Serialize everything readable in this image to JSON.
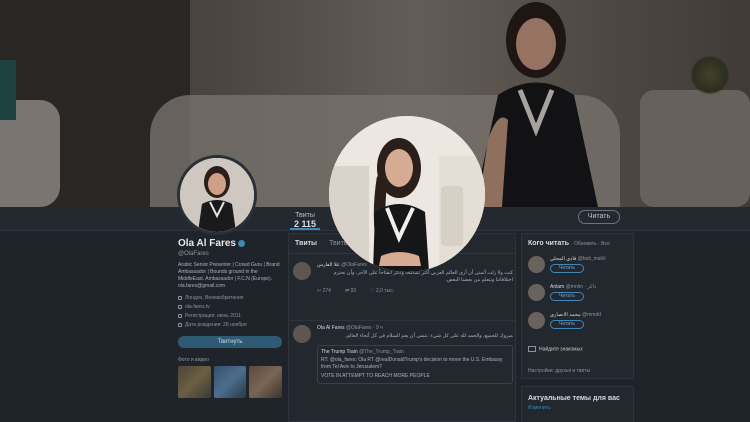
{
  "header": {
    "tab_tweets_label": "Твиты",
    "tab_tweets_value": "2 115",
    "edit_button": "Читать"
  },
  "profile": {
    "name": "Ola Al Fares",
    "handle": "@OlaFares",
    "bio": "Arabic Senior Presenter | Crowd Guru | Brand Ambassador | Bounds ground in the MiddleEast. Ambassador | F.C.N (Europe). ola.fares@gmail.com",
    "location": "Лондон, Великобритания",
    "website": "ola-fares.tv",
    "joined": "Регистрация: июнь 2011",
    "birthday": "Дата рождения: 28 ноября",
    "message_button": "Твитнуть",
    "media_label": "Фото и видео"
  },
  "timeline": {
    "tab_a": "Твиты",
    "tab_b": "Твиты и ответы",
    "tweets": [
      {
        "name": "علا الفارس",
        "handle": "@OlaFares",
        "text": "كنت ولا زلت أتمنى أن أرى العالم العربي أكثر تسامحاً وأكثر انفتاحاً على الآخر، وأن نحترم اختلافاتنا ونتعلم من بعضنا البعض.",
        "replies": "274",
        "retweets": "93",
        "likes": "2,0 тыс."
      },
      {
        "name": "Ola Al Fares",
        "handle": "@OlaFares · 9 ч",
        "text": "مبروك للجميع، والحمد لله على كل شيء. نتمنى أن يعم السلام في كل أنحاء العالم.",
        "quote_name": "The Trump Train",
        "quote_handle": "@The_Trump_Train",
        "quote_text": "RT: @ola_fares: Ola RT @realDonaldTrump's decision to move the U.S. Embassy from Tel Aviv to Jerusalem?",
        "quote_text2": "VOTE IN ATTEMPT TO REACH MORE PEOPLE"
      }
    ]
  },
  "right_panel": {
    "title": "Кого читать",
    "title_sub": "· Обновить · Все",
    "suggestions": [
      {
        "name": "فادي المحلي",
        "handle": "@fadi_mahli",
        "button": "Читать"
      },
      {
        "name": "Anlam",
        "handle": "@mnlm · ذاكر",
        "button": "Читать"
      },
      {
        "name": "محمد الانصاري",
        "handle": "@mmdd",
        "button": "Читать"
      }
    ],
    "find": "Найдите знакомых",
    "find_sub": "Настройки: друзья и твиты",
    "trends_title": "Актуальные темы для вас",
    "trends_sub": "Изменить"
  }
}
